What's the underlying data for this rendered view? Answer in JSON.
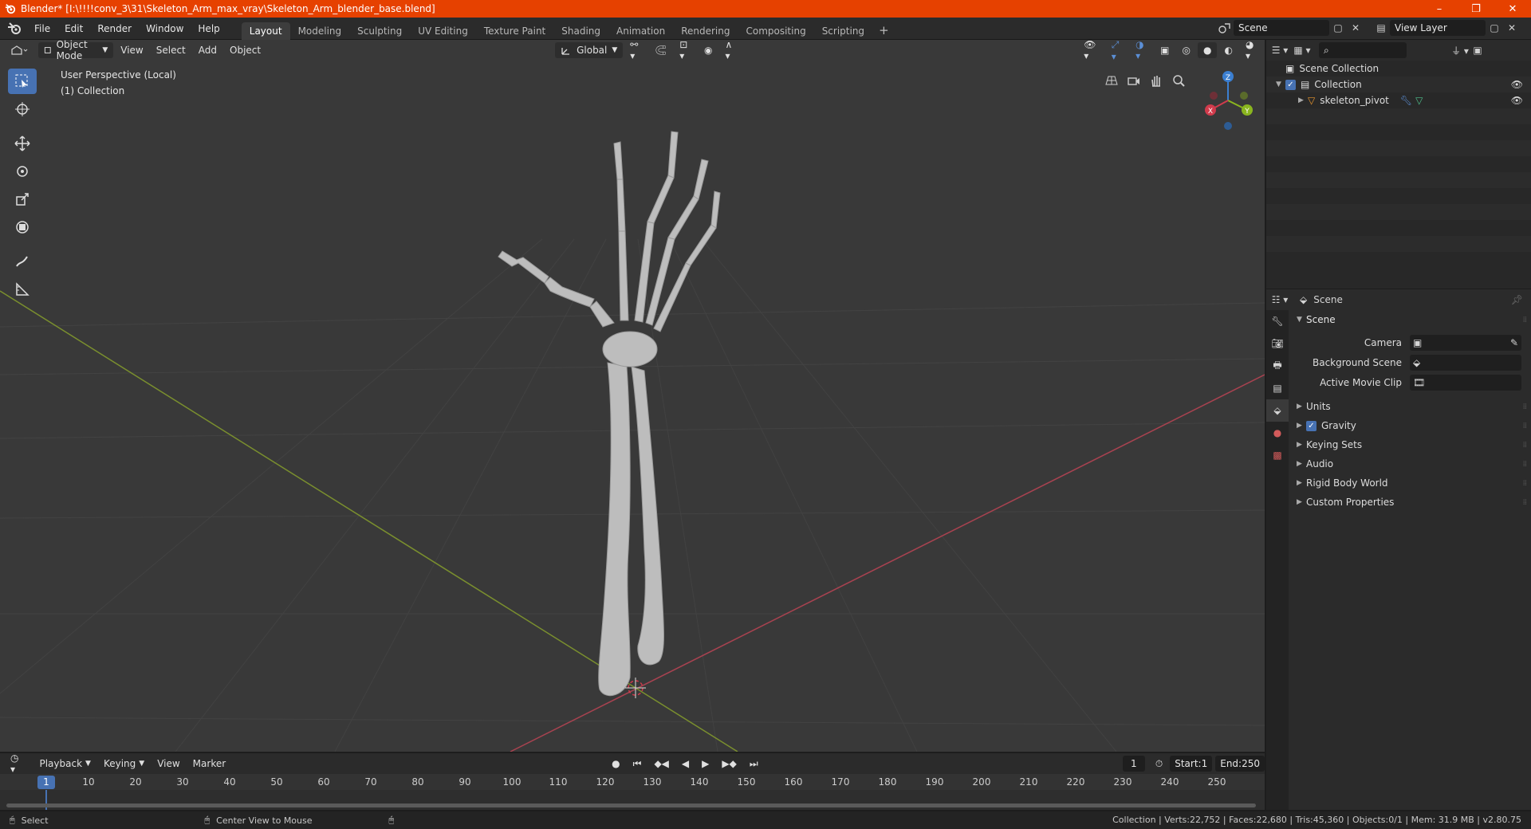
{
  "window": {
    "title": "Blender* [I:\\!!!!conv_3\\31\\Skeleton_Arm_max_vray\\Skeleton_Arm_blender_base.blend]",
    "minimize": "–",
    "restore": "❐",
    "close": "✕"
  },
  "menu": [
    "File",
    "Edit",
    "Render",
    "Window",
    "Help"
  ],
  "workspaces": [
    "Layout",
    "Modeling",
    "Sculpting",
    "UV Editing",
    "Texture Paint",
    "Shading",
    "Animation",
    "Rendering",
    "Compositing",
    "Scripting"
  ],
  "active_workspace": "Layout",
  "scene_selector": {
    "value": "Scene"
  },
  "view_layer_selector": {
    "value": "View Layer"
  },
  "viewport": {
    "mode": "Object Mode",
    "menus": [
      "View",
      "Select",
      "Add",
      "Object"
    ],
    "orientation": "Global",
    "perspective_label": "User Perspective (Local)",
    "collection_label": "(1) Collection",
    "gizmo_axes": {
      "x": "X",
      "y": "Y",
      "z": "Z"
    }
  },
  "outliner": {
    "search_placeholder": "",
    "rows": [
      {
        "label": "Scene Collection"
      },
      {
        "label": "Collection"
      },
      {
        "label": "skeleton_pivot"
      }
    ]
  },
  "properties": {
    "context": "Scene",
    "panel_title": "Scene",
    "fields": [
      {
        "label": "Camera",
        "value": ""
      },
      {
        "label": "Background Scene",
        "value": ""
      },
      {
        "label": "Active Movie Clip",
        "value": ""
      }
    ],
    "subpanels": [
      {
        "label": "Units",
        "checkbox": false
      },
      {
        "label": "Gravity",
        "checkbox": true
      },
      {
        "label": "Keying Sets",
        "checkbox": false
      },
      {
        "label": "Audio",
        "checkbox": false
      },
      {
        "label": "Rigid Body World",
        "checkbox": false
      },
      {
        "label": "Custom Properties",
        "checkbox": false
      }
    ]
  },
  "timeline": {
    "menus": [
      "Playback",
      "Keying",
      "View",
      "Marker"
    ],
    "current_frame": "1",
    "start_label": "Start:",
    "start": "1",
    "end_label": "End:",
    "end": "250",
    "ticks": [
      "10",
      "20",
      "30",
      "40",
      "50",
      "60",
      "70",
      "80",
      "90",
      "100",
      "110",
      "120",
      "130",
      "140",
      "150",
      "160",
      "170",
      "180",
      "190",
      "200",
      "210",
      "220",
      "230",
      "240",
      "250"
    ]
  },
  "statusbar": {
    "left_action": "Select",
    "middle_action": "Center View to Mouse",
    "stats": "Collection | Verts:22,752 | Faces:22,680 | Tris:45,360 | Objects:0/1 | Mem: 31.9 MB | v2.80.75"
  },
  "colors": {
    "titlebar": "#e64100",
    "accent": "#4772b3",
    "axis_x": "#d13b4c",
    "axis_y": "#8ab51f",
    "axis_z": "#3b7fd1"
  }
}
